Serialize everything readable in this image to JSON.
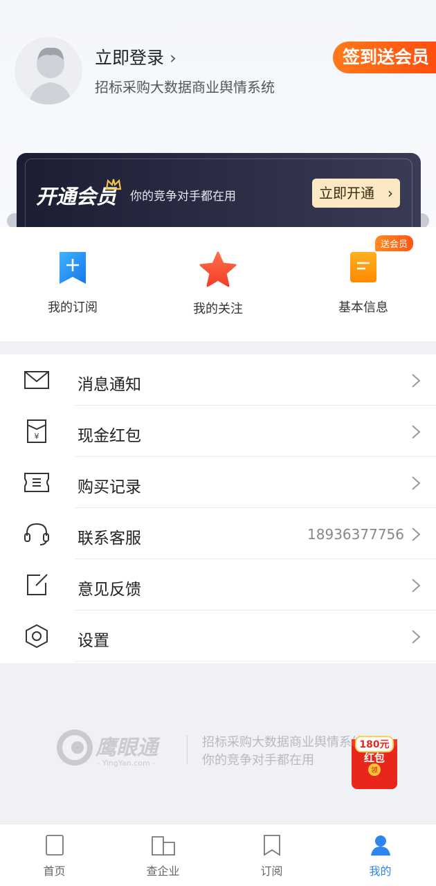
{
  "profile": {
    "login_label": "立即登录",
    "chevron": "›",
    "subtitle": "招标采购大数据商业舆情系统",
    "signin_badge": "签到送会员"
  },
  "vip": {
    "title": "开通会员",
    "slogan": "你的竞争对手都在用",
    "button": "立即开通",
    "button_chevron": "›"
  },
  "quick": [
    {
      "label": "我的订阅",
      "icon": "bookmark-plus-icon"
    },
    {
      "label": "我的关注",
      "icon": "star-icon"
    },
    {
      "label": "基本信息",
      "icon": "info-card-icon"
    }
  ],
  "quick_badge": "送会员",
  "menu": [
    {
      "label": "消息通知",
      "icon": "mail-icon",
      "value": ""
    },
    {
      "label": "现金红包",
      "icon": "red-packet-icon",
      "value": ""
    },
    {
      "label": "购买记录",
      "icon": "ticket-icon",
      "value": ""
    },
    {
      "label": "联系客服",
      "icon": "headset-icon",
      "value": "18936377756"
    },
    {
      "label": "意见反馈",
      "icon": "edit-icon",
      "value": ""
    },
    {
      "label": "设置",
      "icon": "settings-hex-icon",
      "value": ""
    }
  ],
  "footer": {
    "brand": "鹰眼通",
    "brand_url": "- YingYan.com -",
    "line1": "招标采购大数据商业舆情系统",
    "line2": "你的竞争对手都在用",
    "red_packet_amount": "180元",
    "red_packet_label": "红包",
    "red_packet_claim": "领"
  },
  "tabs": [
    {
      "label": "首页",
      "icon": "home-icon",
      "active": false
    },
    {
      "label": "查企业",
      "icon": "building-icon",
      "active": false
    },
    {
      "label": "订阅",
      "icon": "bookmark-icon",
      "active": false
    },
    {
      "label": "我的",
      "icon": "person-icon",
      "active": true
    }
  ],
  "colors": {
    "accent": "#2d86ee",
    "orange": "#ff5515",
    "vip_dark": "#1b1d33",
    "vip_gold": "#fbe9c4"
  }
}
